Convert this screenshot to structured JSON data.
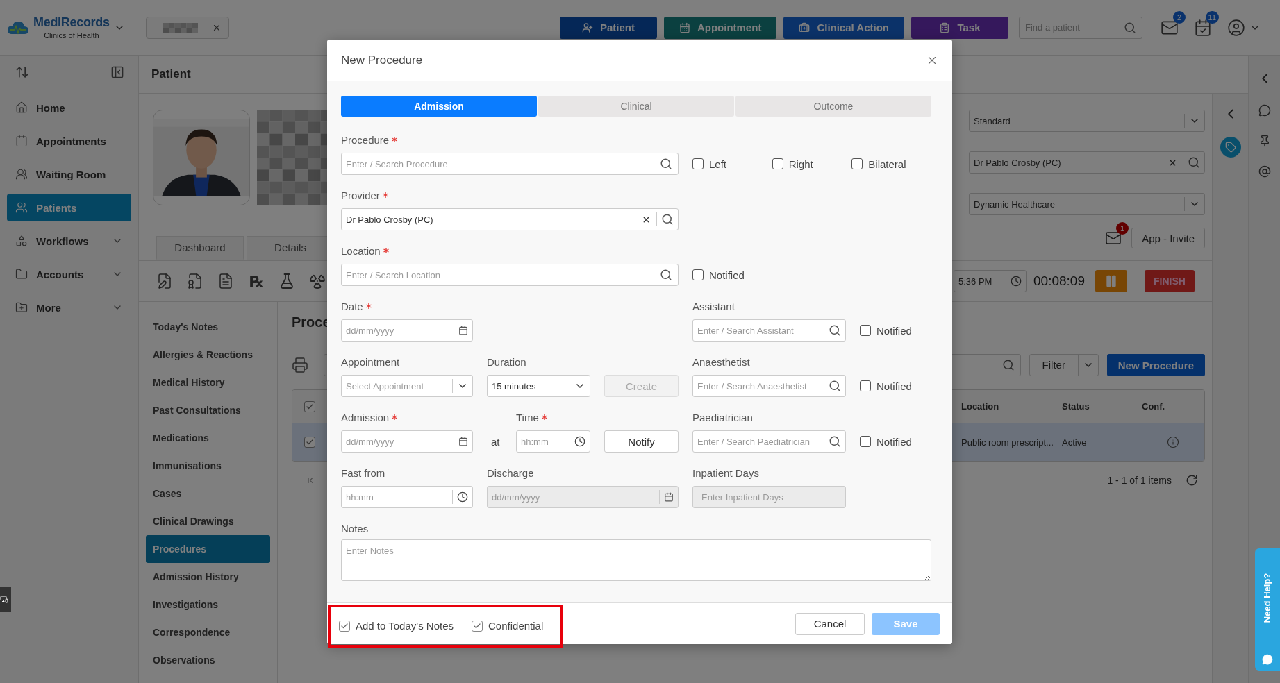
{
  "header": {
    "brand": "MediRecords",
    "subtitle": "Clinics of Health",
    "actions": [
      {
        "label": "Patient"
      },
      {
        "label": "Appointment"
      },
      {
        "label": "Clinical Action"
      },
      {
        "label": "Task"
      }
    ],
    "search": {
      "placeholder": "Find a patient"
    },
    "mail_badge": "2",
    "tasks_badge": "11"
  },
  "sidebar": {
    "items": [
      {
        "label": "Home",
        "selected": false,
        "submenu": false
      },
      {
        "label": "Appointments",
        "selected": false,
        "submenu": false
      },
      {
        "label": "Waiting Room",
        "selected": false,
        "submenu": false
      },
      {
        "label": "Patients",
        "selected": true,
        "submenu": false
      },
      {
        "label": "Workflows",
        "selected": false,
        "submenu": true
      },
      {
        "label": "Accounts",
        "selected": false,
        "submenu": true
      },
      {
        "label": "More",
        "selected": false,
        "submenu": true
      }
    ]
  },
  "patient": {
    "title": "Patient",
    "tabs": [
      {
        "label": "Dashboard",
        "selected": false
      },
      {
        "label": "Details",
        "selected": false
      }
    ],
    "rx_symbol": "℞"
  },
  "subnav": [
    {
      "label": "Today's Notes",
      "selected": false
    },
    {
      "label": "Allergies & Reactions",
      "selected": false
    },
    {
      "label": "Medical History",
      "selected": false
    },
    {
      "label": "Past Consultations",
      "selected": false
    },
    {
      "label": "Medications",
      "selected": false
    },
    {
      "label": "Immunisations",
      "selected": false
    },
    {
      "label": "Cases",
      "selected": false
    },
    {
      "label": "Clinical Drawings",
      "selected": false
    },
    {
      "label": "Procedures",
      "selected": true
    },
    {
      "label": "Admission History",
      "selected": false
    },
    {
      "label": "Investigations",
      "selected": false
    },
    {
      "label": "Correspondence",
      "selected": false
    },
    {
      "label": "Observations",
      "selected": false
    }
  ],
  "procedures": {
    "title": "Proce",
    "filter": "Filter",
    "new_button": "New Procedure",
    "header_checked": true,
    "columns": [
      "Location",
      "Status",
      "Conf."
    ],
    "rows": [
      {
        "selected": true,
        "checked": true,
        "location": "Public room prescript...",
        "status": "Active"
      }
    ],
    "pager": "1 - 1 of 1 items"
  },
  "details": {
    "billing": "Standard",
    "provider": "Dr Pablo Crosby (PC)",
    "practice": "Dynamic Healthcare",
    "mail_badge": "1",
    "invite": "App - Invite",
    "time": "5:36 PM",
    "timer": "00:08:09",
    "finish": "FINISH"
  },
  "help": "Need Help?",
  "modal": {
    "title": "New Procedure",
    "tabs": [
      {
        "label": "Admission",
        "selected": true
      },
      {
        "label": "Clinical",
        "selected": false
      },
      {
        "label": "Outcome",
        "selected": false
      }
    ],
    "procedure": {
      "label": "Procedure",
      "required": true,
      "placeholder": "Enter / Search Procedure"
    },
    "sides": [
      {
        "label": "Left",
        "checked": false
      },
      {
        "label": "Right",
        "checked": false
      },
      {
        "label": "Bilateral",
        "checked": false
      }
    ],
    "provider": {
      "label": "Provider",
      "required": true,
      "value": "Dr Pablo Crosby (PC)"
    },
    "location": {
      "label": "Location",
      "required": true,
      "placeholder": "Enter / Search Location",
      "notified": {
        "label": "Notified",
        "checked": false
      }
    },
    "date": {
      "label": "Date",
      "required": true,
      "placeholder": "dd/mm/yyyy"
    },
    "assistant": {
      "label": "Assistant",
      "required": false,
      "placeholder": "Enter / Search Assistant",
      "notified": {
        "label": "Notified",
        "checked": false
      }
    },
    "appointment": {
      "label": "Appointment",
      "required": false,
      "placeholder": "Select Appointment"
    },
    "duration": {
      "label": "Duration",
      "required": false,
      "value": "15 minutes"
    },
    "create": {
      "label": "Create",
      "disabled": true
    },
    "anaesthetist": {
      "label": "Anaesthetist",
      "required": false,
      "placeholder": "Enter / Search Anaesthetist",
      "notified": {
        "label": "Notified",
        "checked": false
      }
    },
    "admission": {
      "label": "Admission",
      "required": true,
      "placeholder": "dd/mm/yyyy"
    },
    "at": "at",
    "time": {
      "label": "Time",
      "required": true,
      "placeholder": "hh:mm"
    },
    "notify": {
      "label": "Notify",
      "disabled": false
    },
    "paediatrician": {
      "label": "Paediatrician",
      "required": false,
      "placeholder": "Enter / Search Paediatrician",
      "notified": {
        "label": "Notified",
        "checked": false
      }
    },
    "fast_from": {
      "label": "Fast from",
      "required": false,
      "placeholder": "hh:mm"
    },
    "discharge": {
      "label": "Discharge",
      "required": false,
      "placeholder": "dd/mm/yyyy",
      "disabled": true
    },
    "inpatient_days": {
      "label": "Inpatient Days",
      "required": false,
      "placeholder": "Enter Inpatient Days",
      "disabled": true
    },
    "notes": {
      "label": "Notes",
      "required": false,
      "placeholder": "Enter Notes"
    },
    "options": [
      {
        "label": "Add to Today's Notes",
        "checked": true
      },
      {
        "label": "Confidential",
        "checked": true
      }
    ],
    "cancel": {
      "label": "Cancel",
      "disabled": false
    },
    "save": {
      "label": "Save",
      "disabled": true
    }
  }
}
